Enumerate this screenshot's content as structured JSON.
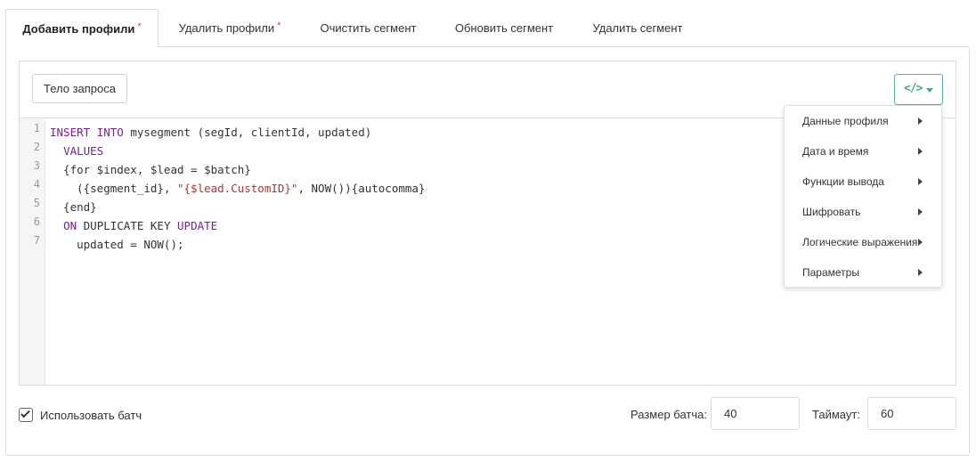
{
  "tabs": [
    {
      "label": "Добавить профили",
      "required": "*",
      "active": true
    },
    {
      "label": "Удалить профили",
      "required": "*",
      "active": false
    },
    {
      "label": "Очистить сегмент",
      "active": false
    },
    {
      "label": "Обновить сегмент",
      "active": false
    },
    {
      "label": "Удалить сегмент",
      "active": false
    }
  ],
  "toolbar": {
    "body_button": "Тело запроса",
    "code_button_icon": "code-icon"
  },
  "editor": {
    "line_numbers": [
      "1",
      "2",
      "3",
      "4",
      "5",
      "6",
      "7"
    ],
    "lines": [
      {
        "parts": [
          {
            "t": "INSERT INTO",
            "c": "kw"
          },
          {
            "t": " mysegment (segId, clientId, updated)",
            "c": ""
          }
        ]
      },
      {
        "parts": [
          {
            "t": "  ",
            "c": ""
          },
          {
            "t": "VALUES",
            "c": "kw"
          }
        ]
      },
      {
        "parts": [
          {
            "t": "  {for $index, $lead = $batch}",
            "c": ""
          }
        ]
      },
      {
        "parts": [
          {
            "t": "    ({segment_id}, ",
            "c": ""
          },
          {
            "t": "\"{$lead.CustomID}\"",
            "c": "str"
          },
          {
            "t": ", NOW()){autocomma}",
            "c": ""
          }
        ]
      },
      {
        "parts": [
          {
            "t": "  {end}",
            "c": ""
          }
        ]
      },
      {
        "parts": [
          {
            "t": "  ",
            "c": ""
          },
          {
            "t": "ON",
            "c": "kw"
          },
          {
            "t": " DUPLICATE KEY ",
            "c": ""
          },
          {
            "t": "UPDATE",
            "c": "kw"
          }
        ]
      },
      {
        "parts": [
          {
            "t": "    updated = NOW();",
            "c": ""
          }
        ]
      }
    ]
  },
  "dropdown": {
    "items": [
      "Данные профиля",
      "Дата и время",
      "Функции вывода",
      "Шифровать",
      "Логические выражения",
      "Параметры"
    ]
  },
  "footer": {
    "use_batch_label": "Использовать батч",
    "use_batch_checked": true,
    "batch_size_label": "Размер батча:",
    "batch_size_value": "40",
    "timeout_label": "Таймаут:",
    "timeout_value": "60"
  },
  "colors": {
    "accent": "#3ab07a",
    "keyword": "#7a1f99",
    "string": "#b5302a",
    "required": "#e53935"
  }
}
